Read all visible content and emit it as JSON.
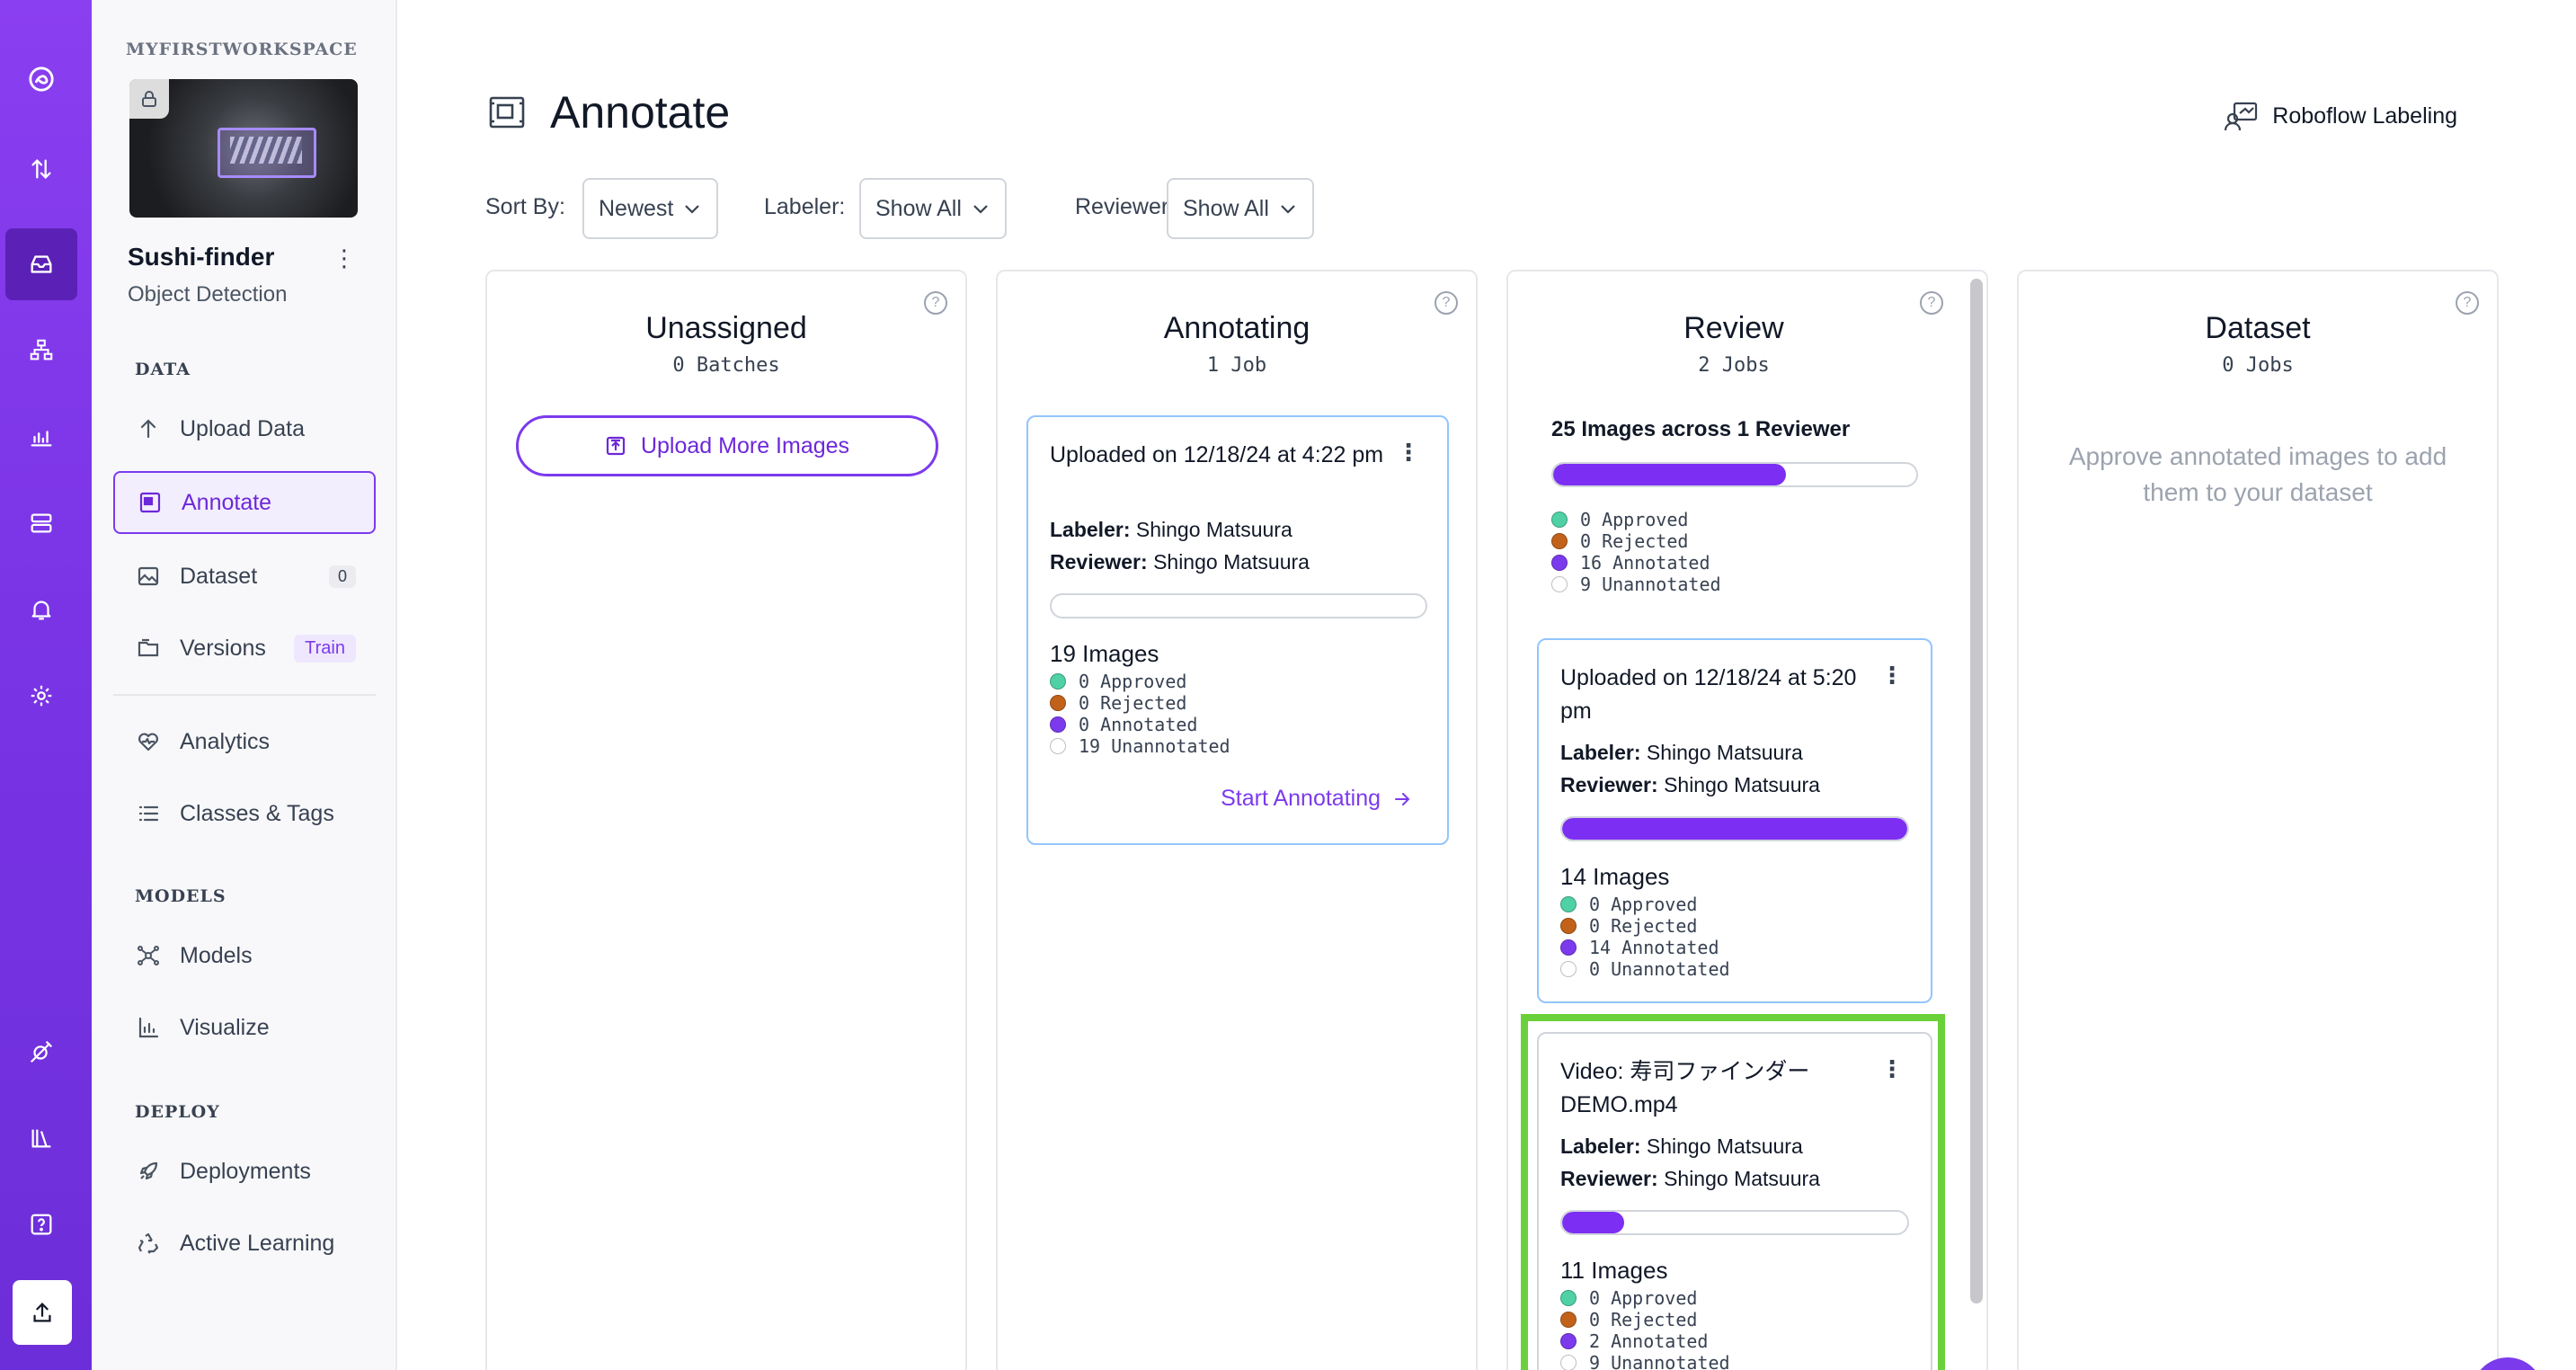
{
  "colors": {
    "brand": "#7c3aed",
    "approved": "#4fd1a5",
    "rejected": "#c2621a",
    "annotated": "#7c3aed",
    "unannotated": "#ffffff",
    "highlight": "#6ad13a"
  },
  "rail": {
    "icons": [
      "roboflow-logo-icon",
      "transfer-icon",
      "inbox-icon",
      "workflow-icon",
      "chart-icon",
      "server-icon",
      "bell-icon",
      "gear-icon",
      "satellite-icon",
      "library-icon",
      "help-icon",
      "upload-icon"
    ]
  },
  "sidebar": {
    "workspace": "MYFIRSTWORKSPACE",
    "project_name": "Sushi-finder",
    "project_type": "Object Detection",
    "data_section": "DATA",
    "models_section": "MODELS",
    "deploy_section": "DEPLOY",
    "items": [
      {
        "label": "Upload Data"
      },
      {
        "label": "Annotate"
      },
      {
        "label": "Dataset",
        "badge": "0"
      },
      {
        "label": "Versions",
        "badge": "Train"
      },
      {
        "label": "Analytics"
      },
      {
        "label": "Classes & Tags"
      },
      {
        "label": "Models"
      },
      {
        "label": "Visualize"
      },
      {
        "label": "Deployments"
      },
      {
        "label": "Active Learning"
      }
    ]
  },
  "header": {
    "title": "Annotate",
    "roboflow_labeling": "Roboflow Labeling"
  },
  "filters": {
    "sort_label": "Sort By:",
    "sort_value": "Newest",
    "labeler_label": "Labeler:",
    "labeler_value": "Show All",
    "reviewer_label": "Reviewer:",
    "reviewer_value": "Show All"
  },
  "columns": {
    "unassigned": {
      "title": "Unassigned",
      "count": "0 Batches",
      "upload_button": "Upload More Images"
    },
    "annotating": {
      "title": "Annotating",
      "count": "1 Job",
      "card": {
        "title": "Uploaded on 12/18/24 at 4:22 pm",
        "labeler_label": "Labeler:",
        "labeler": "Shingo Matsuura",
        "reviewer_label": "Reviewer:",
        "reviewer": "Shingo Matsuura",
        "progress": 0,
        "images": "19 Images",
        "stats": [
          "0 Approved",
          "0 Rejected",
          "0 Annotated",
          "19 Unannotated"
        ],
        "action": "Start Annotating"
      }
    },
    "review": {
      "title": "Review",
      "count": "2 Jobs",
      "summary": "25 Images across 1 Reviewer",
      "summary_progress": 0.64,
      "summary_stats": [
        "0 Approved",
        "0 Rejected",
        "16 Annotated",
        "9 Unannotated"
      ],
      "cards": [
        {
          "title": "Uploaded on 12/18/24 at 5:20 pm",
          "labeler_label": "Labeler:",
          "labeler": "Shingo Matsuura",
          "reviewer_label": "Reviewer:",
          "reviewer": "Shingo Matsuura",
          "progress": 1.0,
          "images": "14 Images",
          "stats": [
            "0 Approved",
            "0 Rejected",
            "14 Annotated",
            "0 Unannotated"
          ]
        },
        {
          "title": "Video: 寿司ファインダー DEMO.mp4",
          "labeler_label": "Labeler:",
          "labeler": "Shingo Matsuura",
          "reviewer_label": "Reviewer:",
          "reviewer": "Shingo Matsuura",
          "progress": 0.18,
          "images": "11 Images",
          "stats": [
            "0 Approved",
            "0 Rejected",
            "2 Annotated",
            "9 Unannotated"
          ]
        }
      ]
    },
    "dataset": {
      "title": "Dataset",
      "count": "0 Jobs",
      "message": "Approve annotated images to add them to your dataset"
    }
  }
}
